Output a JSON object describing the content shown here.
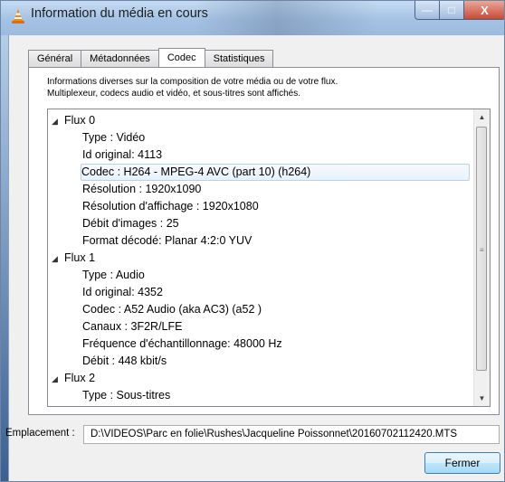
{
  "window": {
    "title": "Information du média en cours",
    "controls": {
      "minimize": "—",
      "maximize": "□",
      "close": "X"
    }
  },
  "tabs": [
    {
      "label": "Général",
      "active": false
    },
    {
      "label": "Métadonnées",
      "active": false
    },
    {
      "label": "Codec",
      "active": true
    },
    {
      "label": "Statistiques",
      "active": false
    }
  ],
  "description": {
    "line1": "Informations diverses sur la composition de votre média ou de votre flux.",
    "line2": "Multiplexeur, codecs audio et vidéo, et sous-titres sont affichés."
  },
  "tree": {
    "selected_index": 3,
    "rows": [
      {
        "text": "Flux 0",
        "level": 0,
        "expanded": true
      },
      {
        "text": "Type : Vidéo",
        "level": 1
      },
      {
        "text": "Id original: 4113",
        "level": 1
      },
      {
        "text": "Codec : H264 - MPEG-4 AVC (part 10) (h264)",
        "level": 1
      },
      {
        "text": "Résolution : 1920x1090",
        "level": 1
      },
      {
        "text": "Résolution d'affichage : 1920x1080",
        "level": 1
      },
      {
        "text": "Débit d'images : 25",
        "level": 1
      },
      {
        "text": "Format décodé: Planar 4:2:0 YUV",
        "level": 1
      },
      {
        "text": "Flux 1",
        "level": 0,
        "expanded": true
      },
      {
        "text": "Type : Audio",
        "level": 1
      },
      {
        "text": "Id original: 4352",
        "level": 1
      },
      {
        "text": "Codec : A52 Audio (aka AC3) (a52 )",
        "level": 1
      },
      {
        "text": "Canaux : 3F2R/LFE",
        "level": 1
      },
      {
        "text": "Fréquence d'échantillonnage: 48000 Hz",
        "level": 1
      },
      {
        "text": "Débit : 448 kbit/s",
        "level": 1
      },
      {
        "text": "Flux 2",
        "level": 0,
        "expanded": true
      },
      {
        "text": "Type : Sous-titres",
        "level": 1
      }
    ],
    "expand_glyph": "◢",
    "scroll_up_glyph": "▲",
    "scroll_down_glyph": "▼",
    "scroll_position": 0.0
  },
  "location": {
    "label": "Emplacement :",
    "value": "D:\\VIDEOS\\Parc en folie\\Rushes\\Jacqueline Poissonnet\\20160702112420.MTS"
  },
  "buttons": {
    "close": "Fermer"
  },
  "colors": {
    "title_bar": "#a9c4e2",
    "close_button": "#c94a35",
    "selection_border": "#b7d2f0",
    "default_button_border": "#3c7fb1"
  },
  "icons": {
    "app": "vlc-cone-icon"
  }
}
